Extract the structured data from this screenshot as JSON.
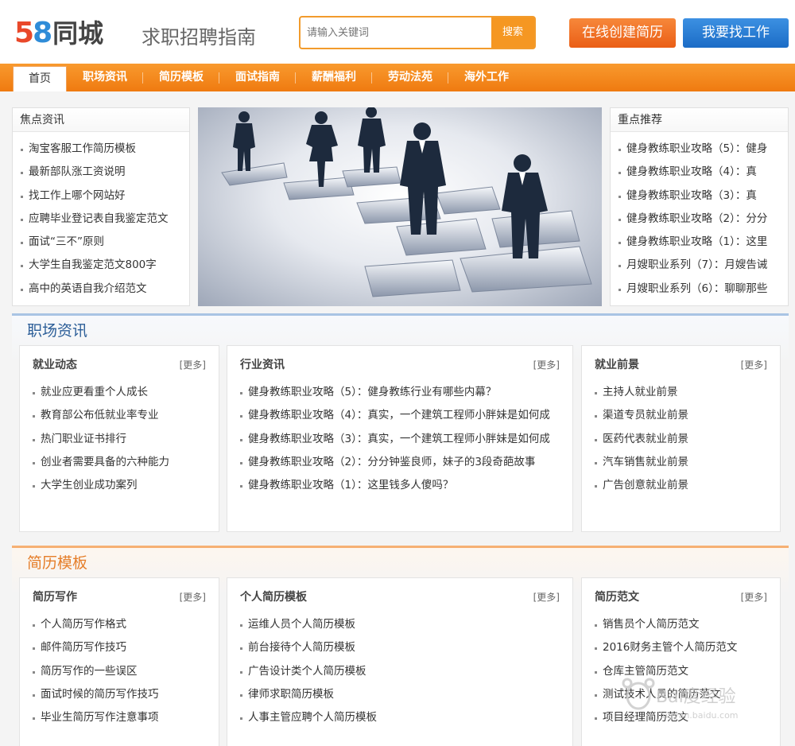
{
  "header": {
    "logo_num": "58",
    "logo_text": "同城",
    "site_title": "求职招聘指南",
    "search_placeholder": "请输入关键词",
    "search_button": "搜索",
    "create_resume": "在线创建简历",
    "find_job": "我要找工作"
  },
  "nav": {
    "items": [
      "首页",
      "职场资讯",
      "简历模板",
      "面试指南",
      "薪酬福利",
      "劳动法苑",
      "海外工作"
    ]
  },
  "focus": {
    "title": "焦点资讯",
    "items": [
      "淘宝客服工作简历模板",
      "最新部队涨工资说明",
      "找工作上哪个网站好",
      "应聘毕业登记表自我鉴定范文",
      "面试“三不”原则",
      "大学生自我鉴定范文800字",
      "高中的英语自我介绍范文"
    ]
  },
  "recommend": {
    "title": "重点推荐",
    "items": [
      "健身教练职业攻略（5）：健身",
      "健身教练职业攻略（4）：真",
      "健身教练职业攻略（3）：真",
      "健身教练职业攻略（2）：分分",
      "健身教练职业攻略（1）：这里",
      "月嫂职业系列（7）：月嫂告诫",
      "月嫂职业系列（6）：聊聊那些"
    ]
  },
  "section1": {
    "title": "职场资讯",
    "panels": [
      {
        "title": "就业动态",
        "more": "[更多]",
        "items": [
          "就业应更看重个人成长",
          "教育部公布低就业率专业",
          "热门职业证书排行",
          "创业者需要具备的六种能力",
          "大学生创业成功案列"
        ]
      },
      {
        "title": "行业资讯",
        "more": "[更多]",
        "items": [
          "健身教练职业攻略（5）：健身教练行业有哪些内幕？",
          "健身教练职业攻略（4）：真实，一个建筑工程师小胖妹是如何成",
          "健身教练职业攻略（3）：真实，一个建筑工程师小胖妹是如何成",
          "健身教练职业攻略（2）：分分钟鉴良师，妹子的3段奇葩故事",
          "健身教练职业攻略（1）：这里钱多人傻吗？"
        ]
      },
      {
        "title": "就业前景",
        "more": "[更多]",
        "items": [
          "主持人就业前景",
          "渠道专员就业前景",
          "医药代表就业前景",
          "汽车销售就业前景",
          "广告创意就业前景"
        ]
      }
    ]
  },
  "section2": {
    "title": "简历模板",
    "panels": [
      {
        "title": "简历写作",
        "more": "[更多]",
        "items": [
          "个人简历写作格式",
          "邮件简历写作技巧",
          "简历写作的一些误区",
          "面试时候的简历写作技巧",
          "毕业生简历写作注意事项"
        ]
      },
      {
        "title": "个人简历模板",
        "more": "[更多]",
        "items": [
          "运维人员个人简历模板",
          "前台接待个人简历模板",
          "广告设计类个人简历模板",
          "律师求职简历模板",
          "人事主管应聘个人简历模板"
        ]
      },
      {
        "title": "简历范文",
        "more": "[更多]",
        "items": [
          "销售员个人简历范文",
          "2016财务主管个人简历范文",
          "仓库主管简历范文",
          "测试技术人员的简历范文",
          "项目经理简历范文"
        ]
      }
    ]
  },
  "watermark": {
    "text": "Bai度经验",
    "sub": "jingyan.baidu.com"
  },
  "colors": {
    "orange": "#f59722",
    "blue": "#1b6cc6",
    "section_blue": "#2c5e98",
    "section_orange": "#e57e2a"
  }
}
